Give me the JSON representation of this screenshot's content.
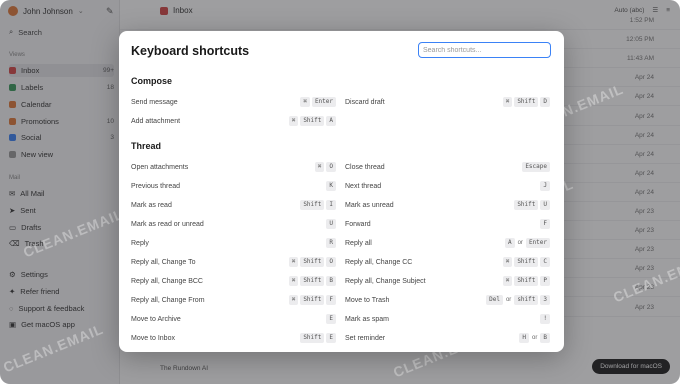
{
  "sidebar": {
    "user_name": "John Johnson",
    "search_label": "Search",
    "views_label": "Views",
    "views": [
      {
        "label": "Inbox",
        "count": "99+",
        "color": "#d64545"
      },
      {
        "label": "Labels",
        "count": "18",
        "color": "#3a9a5b"
      },
      {
        "label": "Calendar",
        "count": "",
        "color": "#e0793a"
      },
      {
        "label": "Promotions",
        "count": "10",
        "color": "#e0793a"
      },
      {
        "label": "Social",
        "count": "3",
        "color": "#3b82f6"
      },
      {
        "label": "New view",
        "count": "",
        "color": "#999999"
      }
    ],
    "mail_label": "Mail",
    "mail": [
      {
        "label": "All Mail"
      },
      {
        "label": "Sent"
      },
      {
        "label": "Drafts"
      },
      {
        "label": "Trash"
      }
    ],
    "bottom": [
      {
        "label": "Settings"
      },
      {
        "label": "Refer friend"
      },
      {
        "label": "Support & feedback"
      },
      {
        "label": "Get macOS app"
      }
    ]
  },
  "main": {
    "title": "Inbox",
    "auto_label": "Auto (abc)",
    "times": [
      "1:52 PM",
      "12:05 PM",
      "11:43 AM",
      "Apr 24",
      "Apr 24",
      "Apr 24",
      "Apr 24",
      "Apr 24",
      "Apr 24",
      "Apr 24",
      "Apr 23",
      "Apr 23",
      "Apr 23",
      "Apr 23",
      "Apr 23",
      "Apr 23"
    ],
    "bottom_text": "The Rundown AI",
    "download_label": "Download for macOS"
  },
  "watermark": "CLEAN.EMAIL",
  "modal": {
    "title": "Keyboard shortcuts",
    "search_placeholder": "Search shortcuts...",
    "compose_title": "Compose",
    "thread_title": "Thread",
    "compose": [
      {
        "label": "Send message",
        "keys": [
          "⌘",
          "Enter"
        ]
      },
      {
        "label": "Discard draft",
        "keys": [
          "⌘",
          "Shift",
          "D"
        ]
      },
      {
        "label": "Add attachment",
        "keys": [
          "⌘",
          "Shift",
          "A"
        ]
      }
    ],
    "thread": [
      {
        "label": "Open attachments",
        "keys": [
          "⌘",
          "O"
        ]
      },
      {
        "label": "Close thread",
        "keys": [
          "Escape"
        ]
      },
      {
        "label": "Previous thread",
        "keys": [
          "K"
        ]
      },
      {
        "label": "Next thread",
        "keys": [
          "J"
        ]
      },
      {
        "label": "Mark as read",
        "keys": [
          "Shift",
          "I"
        ]
      },
      {
        "label": "Mark as unread",
        "keys": [
          "Shift",
          "U"
        ]
      },
      {
        "label": "Mark as read or unread",
        "keys": [
          "U"
        ]
      },
      {
        "label": "Forward",
        "keys": [
          "F"
        ]
      },
      {
        "label": "Reply",
        "keys": [
          "R"
        ]
      },
      {
        "label": "Reply all",
        "keys": [
          "A",
          "or",
          "Enter"
        ]
      },
      {
        "label": "Reply all, Change To",
        "keys": [
          "⌘",
          "Shift",
          "O"
        ]
      },
      {
        "label": "Reply all, Change CC",
        "keys": [
          "⌘",
          "Shift",
          "C"
        ]
      },
      {
        "label": "Reply all, Change BCC",
        "keys": [
          "⌘",
          "Shift",
          "B"
        ]
      },
      {
        "label": "Reply all, Change Subject",
        "keys": [
          "⌘",
          "Shift",
          "P"
        ]
      },
      {
        "label": "Reply all, Change From",
        "keys": [
          "⌘",
          "Shift",
          "F"
        ]
      },
      {
        "label": "Move to Trash",
        "keys": [
          "Del",
          "or",
          "shift",
          "3"
        ]
      },
      {
        "label": "Move to Archive",
        "keys": [
          "E"
        ]
      },
      {
        "label": "Mark as spam",
        "keys": [
          "!"
        ]
      },
      {
        "label": "Move to Inbox",
        "keys": [
          "Shift",
          "E"
        ]
      },
      {
        "label": "Set reminder",
        "keys": [
          "H",
          "or",
          "B"
        ]
      }
    ]
  }
}
